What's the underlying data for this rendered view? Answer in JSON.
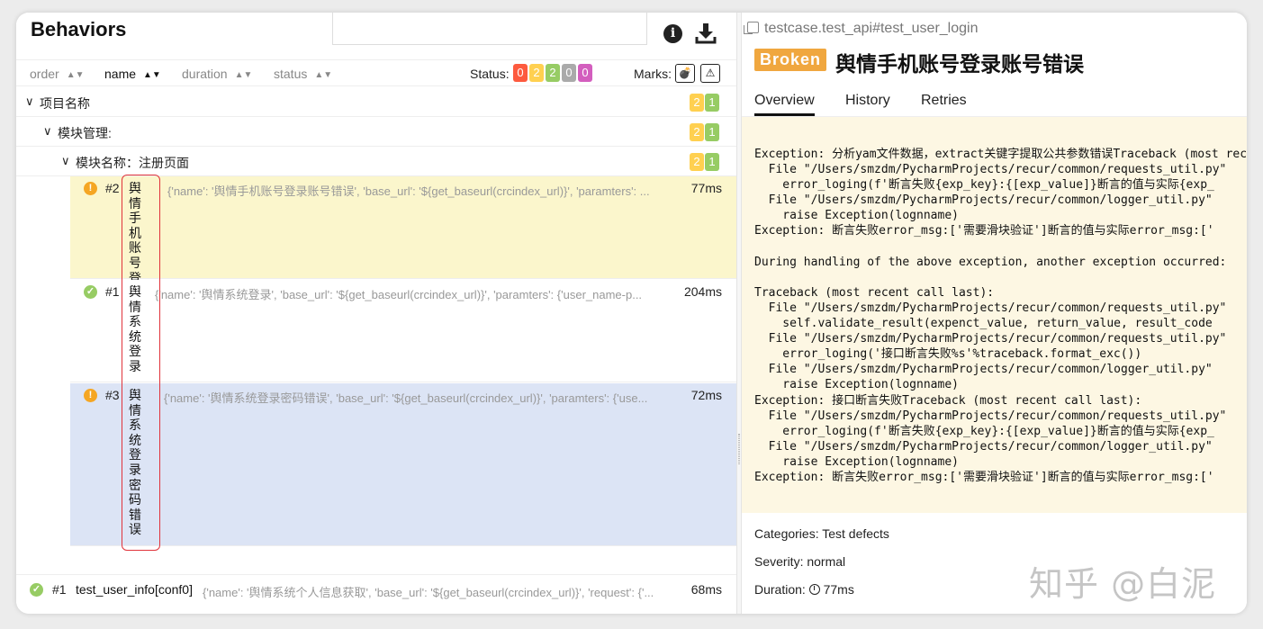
{
  "colors": {
    "failed": "#fd5a3e",
    "broken": "#ffd050",
    "passed": "#97cc64",
    "skipped": "#aaaaaa",
    "unknown": "#d35ebe",
    "broken_badge": "#f0a73f"
  },
  "left": {
    "title": "Behaviors",
    "icons": {
      "info": "info-icon",
      "download": "download-icon"
    },
    "sort": {
      "order": "order",
      "name": "name",
      "duration": "duration",
      "status": "status"
    },
    "status_label": "Status:",
    "status_counts": [
      "0",
      "2",
      "2",
      "0",
      "0"
    ],
    "marks_label": "Marks:",
    "marks": [
      "💣",
      "⚠"
    ],
    "tree": {
      "project": {
        "label": "项目名称",
        "broken": "2",
        "passed": "1"
      },
      "module": {
        "label": "模块管理:",
        "broken": "2",
        "passed": "1"
      },
      "page": {
        "label": "模块名称：注册页面",
        "broken": "2",
        "passed": "1"
      },
      "tests": [
        {
          "num": "#2",
          "name": "舆情手机账号登录账号错误",
          "params": "{'name': '舆情手机账号登录账号错误', 'base_url': '${get_baseurl(crcindex_url)}', 'paramters': ...",
          "duration": "77ms",
          "status": "broken"
        },
        {
          "num": "#1",
          "name": "舆情系统登录",
          "params": "{'name': '舆情系统登录', 'base_url': '${get_baseurl(crcindex_url)}', 'paramters': {'user_name-p...",
          "duration": "204ms",
          "status": "passed"
        },
        {
          "num": "#3",
          "name": "舆情系统登录密码错误",
          "params": "{'name': '舆情系统登录密码错误', 'base_url': '${get_baseurl(crcindex_url)}', 'paramters': {'use...",
          "duration": "72ms",
          "status": "broken"
        }
      ],
      "bottom_test": {
        "num": "#1",
        "name": "test_user_info[conf0]",
        "params": "{'name': '舆情系统个人信息获取', 'base_url': '${get_baseurl(crcindex_url)}', 'request': {'...",
        "duration": "68ms",
        "status": "passed"
      }
    }
  },
  "right": {
    "breadcrumb": "testcase.test_api#test_user_login",
    "status_badge": "Broken",
    "test_title": "舆情手机账号登录账号错误",
    "tabs": [
      "Overview",
      "History",
      "Retries"
    ],
    "trace_lines": [
      "Exception: 分析yam文件数据，extract关键字提取公共参数错误Traceback (most recent call last):",
      "  File \"/Users/smzdm/PycharmProjects/recur/common/requests_util.py\"",
      "    error_loging(f'断言失败{exp_key}:{[exp_value]}断言的值与实际{exp_",
      "  File \"/Users/smzdm/PycharmProjects/recur/common/logger_util.py\"",
      "    raise Exception(lognname)",
      "Exception: 断言失败error_msg:['需要滑块验证']断言的值与实际error_msg:['",
      "",
      "During handling of the above exception, another exception occurred:",
      "",
      "Traceback (most recent call last):",
      "  File \"/Users/smzdm/PycharmProjects/recur/common/requests_util.py\"",
      "    self.validate_result(expenct_value, return_value, result_code",
      "  File \"/Users/smzdm/PycharmProjects/recur/common/requests_util.py\"",
      "    error_loging('接口断言失败%s'%traceback.format_exc())",
      "  File \"/Users/smzdm/PycharmProjects/recur/common/logger_util.py\"",
      "    raise Exception(lognname)",
      "Exception: 接口断言失败Traceback (most recent call last):",
      "  File \"/Users/smzdm/PycharmProjects/recur/common/requests_util.py\"",
      "    error_loging(f'断言失败{exp_key}:{[exp_value]}断言的值与实际{exp_",
      "  File \"/Users/smzdm/PycharmProjects/recur/common/logger_util.py\"",
      "    raise Exception(lognname)",
      "Exception: 断言失败error_msg:['需要滑块验证']断言的值与实际error_msg:['"
    ],
    "categories": "Categories: Test defects",
    "severity": "Severity: normal",
    "duration_label": "Duration:",
    "duration_value": "77ms"
  },
  "watermark": "知乎 @白泥"
}
